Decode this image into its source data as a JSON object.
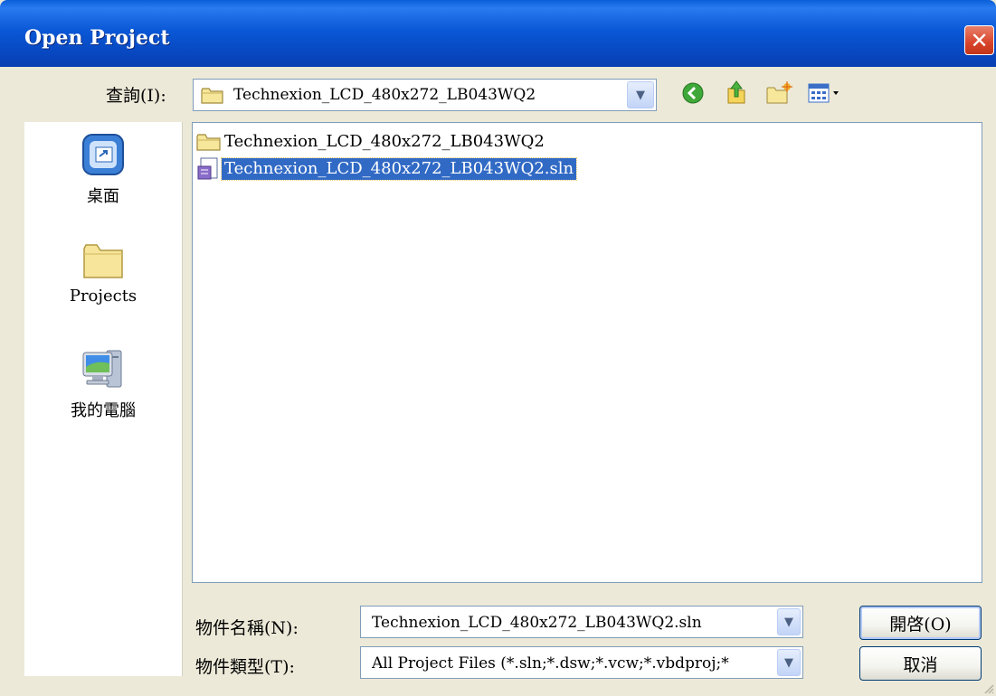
{
  "window": {
    "title": "Open Project",
    "close_glyph": "✕"
  },
  "lookin": {
    "label": "查詢(I):",
    "value": "Technexion_LCD_480x272_LB043WQ2",
    "icon": "folder-icon"
  },
  "toolbar": {
    "back_icon": "back-icon",
    "up_icon": "up-folder-icon",
    "new_folder_icon": "new-folder-icon",
    "views_icon": "views-menu-icon"
  },
  "places": [
    {
      "label": "桌面",
      "icon": "desktop-icon"
    },
    {
      "label": "Projects",
      "icon": "folder-icon"
    },
    {
      "label": "我的電腦",
      "icon": "my-computer-icon"
    }
  ],
  "files": [
    {
      "name": "Technexion_LCD_480x272_LB043WQ2",
      "icon": "folder-icon",
      "selected": false
    },
    {
      "name": "Technexion_LCD_480x272_LB043WQ2.sln",
      "icon": "solution-file-icon",
      "selected": true
    }
  ],
  "filename": {
    "label": "物件名稱(N):",
    "value": "Technexion_LCD_480x272_LB043WQ2.sln"
  },
  "filetype": {
    "label": "物件類型(T):",
    "value": "All Project Files (*.sln;*.dsw;*.vcw;*.vbdproj;*"
  },
  "buttons": {
    "open": "開啓(O)",
    "cancel": "取消"
  },
  "colors": {
    "titlebar": "#0a58d6",
    "selection": "#316ac5",
    "dialog_bg": "#ece9d8"
  }
}
